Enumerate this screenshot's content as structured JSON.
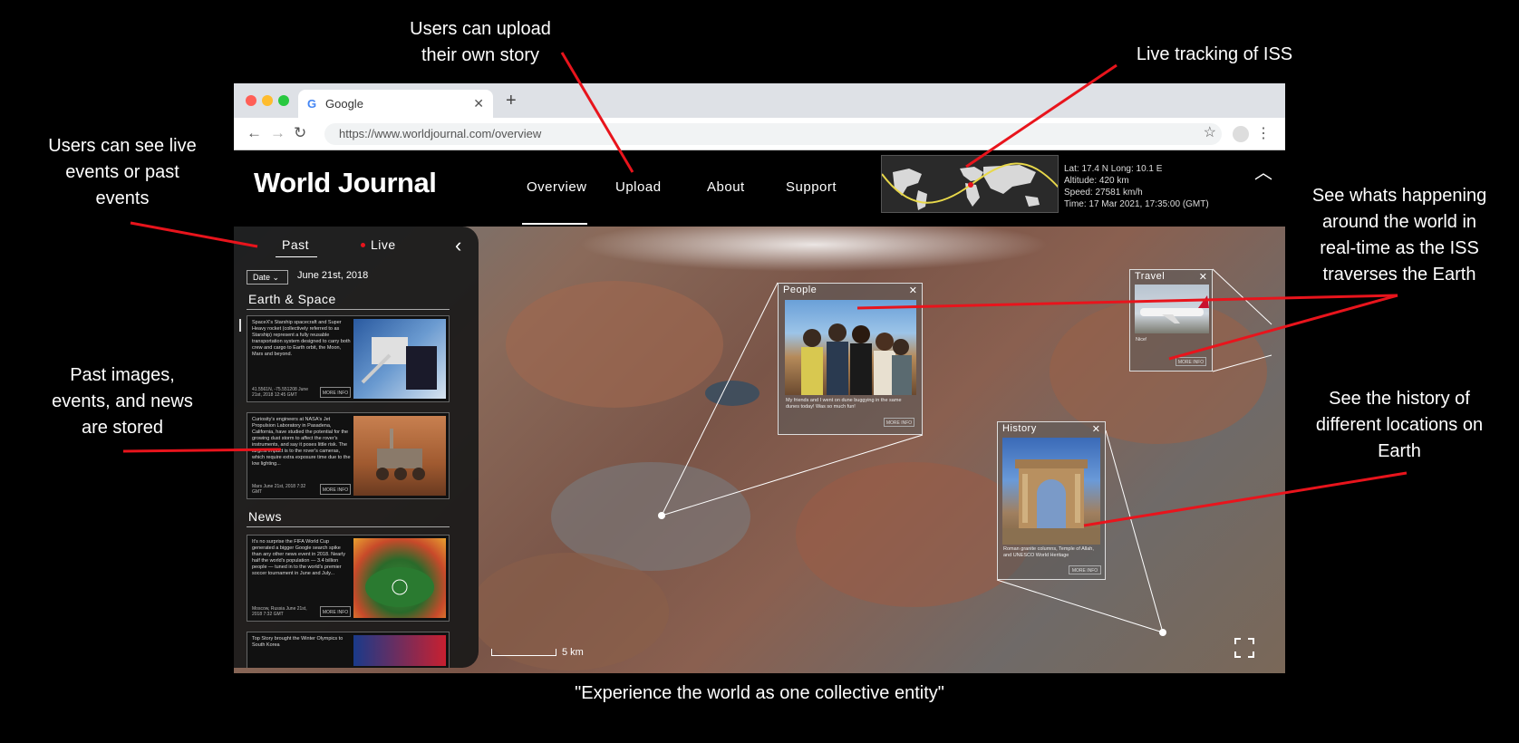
{
  "annotations": {
    "upload": [
      "Users can upload",
      "their own story"
    ],
    "iss": "Live tracking of ISS",
    "live_past": [
      "Users can see live",
      "events or past",
      "events"
    ],
    "stored": [
      "Past images,",
      "events, and news",
      "are stored"
    ],
    "happening": [
      "See whats happening",
      "around the world in",
      "real-time as the ISS",
      "traverses the Earth"
    ],
    "history": [
      "See the history of",
      "different locations on",
      "Earth"
    ]
  },
  "caption": "\"Experience the world as one collective entity\"",
  "browser": {
    "tab_title": "Google",
    "url": "https://www.worldjournal.com/overview"
  },
  "app": {
    "logo": "World Journal",
    "nav": [
      "Overview",
      "Upload",
      "About",
      "Support"
    ],
    "iss": {
      "line1": "Lat: 17.4 N   Long: 10.1 E",
      "line2": "Altitude: 420 km",
      "line3": "Speed: 27581 km/h",
      "line4": "Time: 17 Mar 2021, 17:35:00 (GMT)"
    }
  },
  "sidebar": {
    "tab_past": "Past",
    "tab_live": "Live",
    "date_label": "Date",
    "date_value": "June 21st, 2018",
    "section1": "Earth & Space",
    "section2": "News",
    "cards": [
      {
        "text": "SpaceX's Starship spacecraft and Super Heavy rocket (collectively referred to as Starship) represent a fully reusable transportation system designed to carry both crew and cargo to Earth orbit, the Moon, Mars and beyond.",
        "meta": "41.5561N, -75.551208 June 21st, 2018 12:45 GMT",
        "more": "MORE INFO"
      },
      {
        "text": "Curiosity's engineers at NASA's Jet Propulsion Laboratory in Pasadena, California, have studied the potential for the growing dust storm to affect the rover's instruments, and say it poses little risk. The largest impact is to the rover's cameras, which require extra exposure time due to the low lighting...",
        "meta": "Mars June 21st, 2018 7:32 GMT",
        "more": "MORE INFO"
      },
      {
        "text": "It's no surprise the FIFA World Cup generated a bigger Google search spike than any other news event in 2018. Nearly half the world's population — 3.4 billion people — tuned in to the world's premier soccer tournament in June and July...",
        "meta": "Moscow, Russia June 21st, 2018 7:32 GMT",
        "more": "MORE INFO"
      },
      {
        "text": "Top Story brought the Winter Olympics to South Korea"
      }
    ]
  },
  "popups": {
    "people": {
      "title": "People",
      "text": "My friends and I went on dune buggying in the same dunes today! Was so much fun!",
      "more": "MORE INFO"
    },
    "travel": {
      "title": "Travel",
      "text": "Nice!",
      "more": "MORE INFO"
    },
    "history": {
      "title": "History",
      "text": "Roman granite columns, Temple of Allah, and UNESCO World Heritage",
      "more": "MORE INFO"
    }
  },
  "map": {
    "scale": "5 km"
  },
  "colors": {
    "accent_line": "#e8141c",
    "live_dot": "#e8141c",
    "iss_track": "#e8d84a"
  }
}
